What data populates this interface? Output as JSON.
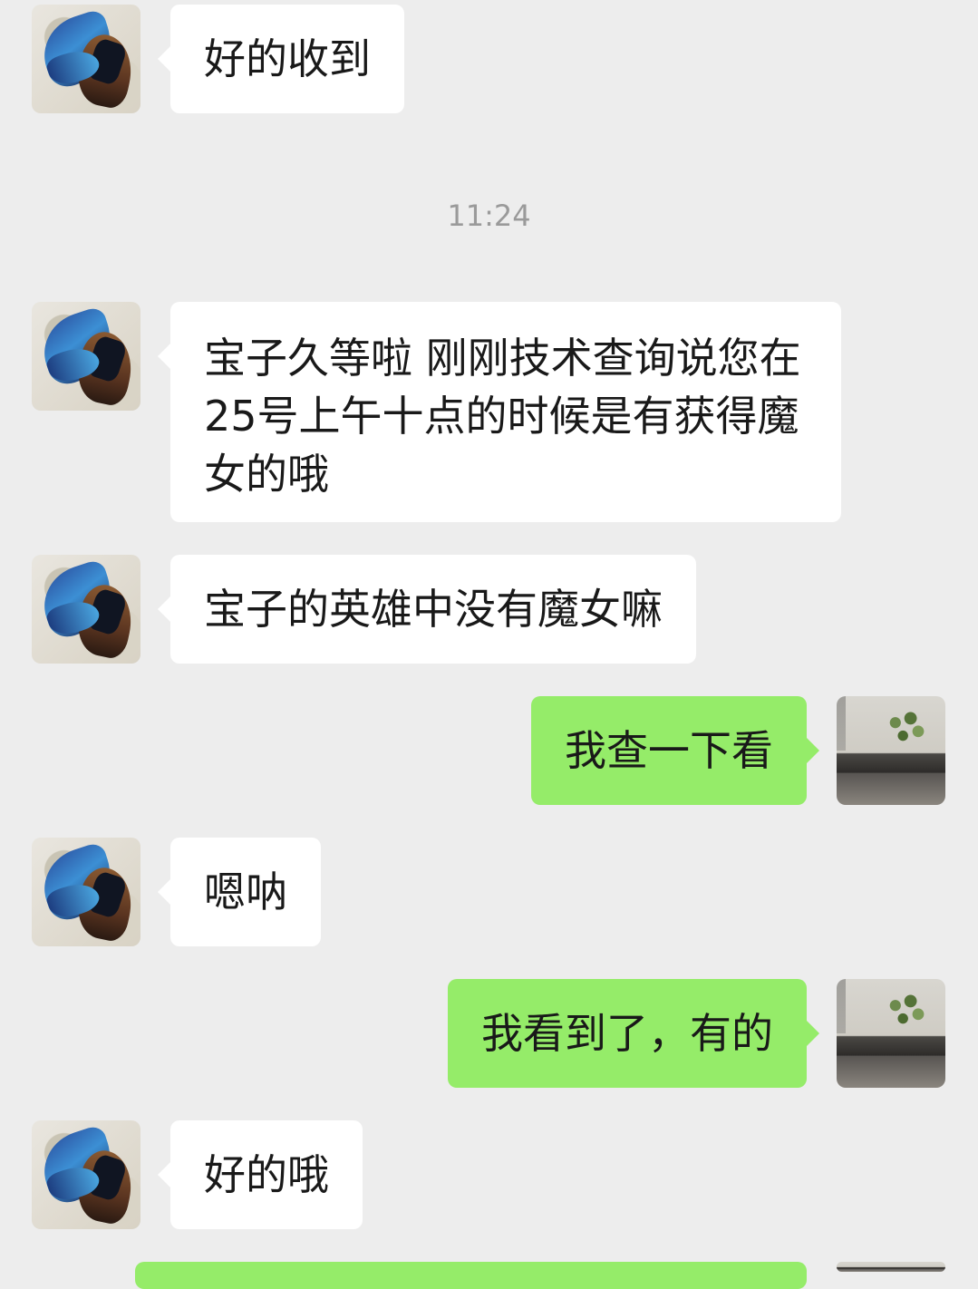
{
  "chat": {
    "timestamp": "11:24",
    "messages": [
      {
        "from": "other",
        "text": "好的收到"
      },
      {
        "from": "other",
        "text": "宝子久等啦 刚刚技术查询说您在25号上午十点的时候是有获得魔女的哦"
      },
      {
        "from": "other",
        "text": "宝子的英雄中没有魔女嘛"
      },
      {
        "from": "self",
        "text": "我查一下看"
      },
      {
        "from": "other",
        "text": "嗯呐"
      },
      {
        "from": "self",
        "text": "我看到了，有的"
      },
      {
        "from": "other",
        "text": "好的哦"
      }
    ]
  },
  "colors": {
    "background": "#ededed",
    "incoming_bubble": "#ffffff",
    "outgoing_bubble": "#95ec69",
    "timestamp_text": "#9a9a9a"
  },
  "icons": {
    "contact_avatar": "dragon-avatar-icon",
    "self_avatar": "plant-avatar-icon"
  }
}
